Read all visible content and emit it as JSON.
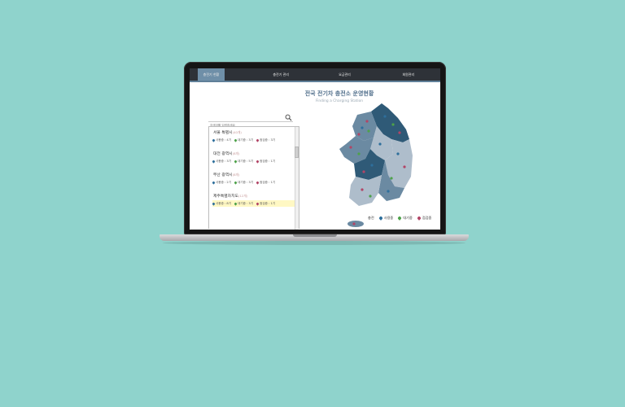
{
  "nav": {
    "items": [
      "충전기 현황",
      "충전기 관리",
      "요금관리",
      "회원관리"
    ]
  },
  "page": {
    "title": "전국 전기차 충전소 운영현황",
    "subtitle": "Finding a Charging Station"
  },
  "search": {
    "placeholder": "검색어를 입력하세요"
  },
  "regions": [
    {
      "name": "서울 특별시",
      "count": "(40개)",
      "in_use": "사용중 : 4기",
      "waiting": "대기중 : 3기",
      "inspect": "점검중 : 3기",
      "highlighted": false
    },
    {
      "name": "대전 광역시",
      "count": "(8개)",
      "in_use": "사용중 : 3기",
      "waiting": "대기중 : 5기",
      "inspect": "점검중 : 1기",
      "highlighted": false
    },
    {
      "name": "부산 광역시",
      "count": "(8개)",
      "in_use": "사용중 : 2기",
      "waiting": "대기중 : 3기",
      "inspect": "점검중 : 1기",
      "highlighted": false
    },
    {
      "name": "제주특별자치도",
      "count": "(12개)",
      "in_use": "사용중 : 8기",
      "waiting": "대기중 : 3기",
      "inspect": "점검중 : 1기",
      "highlighted": true
    }
  ],
  "legend": {
    "label": "충전",
    "in_use": "사용중",
    "waiting": "대기중",
    "inspect": "점검중"
  },
  "colors": {
    "background": "#8fd3cc",
    "nav_bg": "#2e3238",
    "nav_active": "#6f8fa8",
    "title": "#52708c",
    "map_dark": "#2f5a77",
    "map_mid": "#6b8aa2",
    "map_light": "#aebdcb",
    "pin_in_use": "#2e6f9c",
    "pin_waiting": "#4ea24a",
    "pin_inspect": "#b24566",
    "highlight_row": "#fff8c4"
  }
}
